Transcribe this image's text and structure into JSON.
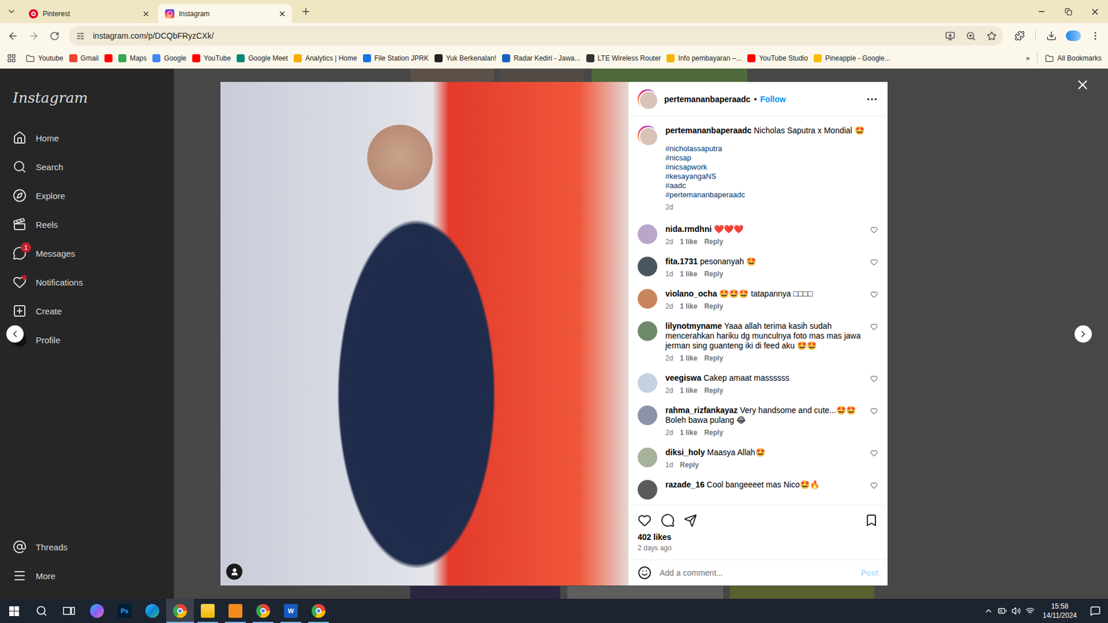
{
  "browser": {
    "tabs": [
      {
        "label": "Pinterest",
        "selected": false
      },
      {
        "label": "Instagram",
        "selected": true
      }
    ],
    "url": "instagram.com/p/DCQbFRyzCXk/",
    "bookmarks": [
      {
        "label": "Youtube",
        "kind": "folder"
      },
      {
        "label": "Gmail",
        "kind": "site",
        "color": "#ea4335"
      },
      {
        "kind": "site",
        "color": "#ff0000"
      },
      {
        "label": "Maps",
        "kind": "site",
        "color": "#34a853"
      },
      {
        "label": "Google",
        "kind": "site",
        "color": "#4285f4"
      },
      {
        "label": "YouTube",
        "kind": "site",
        "color": "#ff0000"
      },
      {
        "label": "Google Meet",
        "kind": "site",
        "color": "#00897b"
      },
      {
        "label": "Analytics | Home",
        "kind": "site",
        "color": "#f9ab00"
      },
      {
        "label": "File Station JPRK",
        "kind": "site",
        "color": "#1a73e8"
      },
      {
        "label": "Yuk Berkenalan!",
        "kind": "site",
        "color": "#222222"
      },
      {
        "label": "Radar Kediri - Jawa...",
        "kind": "site",
        "color": "#1565c0"
      },
      {
        "label": "LTE Wireless Router",
        "kind": "site",
        "color": "#333333"
      },
      {
        "label": "Info pembayaran –...",
        "kind": "site",
        "color": "#f4b400"
      },
      {
        "label": "YouTube Studio",
        "kind": "site",
        "color": "#ff0000"
      },
      {
        "label": "Pineapple - Google...",
        "kind": "site",
        "color": "#fbbc04"
      }
    ],
    "overflow": "»",
    "all_bookmarks": "All Bookmarks"
  },
  "sidebar": {
    "logo": "Instagram",
    "items": [
      {
        "label": "Home",
        "kind": "nav"
      },
      {
        "label": "Search",
        "kind": "nav"
      },
      {
        "label": "Explore",
        "kind": "nav"
      },
      {
        "label": "Reels",
        "kind": "nav"
      },
      {
        "label": "Messages",
        "kind": "nav",
        "badge": "1"
      },
      {
        "label": "Notifications",
        "kind": "nav",
        "dot": true
      },
      {
        "label": "Create",
        "kind": "nav"
      },
      {
        "label": "Profile",
        "kind": "avatar"
      }
    ],
    "bottom_items": [
      {
        "label": "Threads"
      },
      {
        "label": "More"
      }
    ]
  },
  "post": {
    "username": "pertemananbaperaadc",
    "separator": "•",
    "follow": "Follow",
    "caption": {
      "text": "Nicholas Saputra x Mondial 🤩",
      "hashtags": [
        "#nicholassaputra",
        "#nicsap",
        "#nicsapwork",
        "#kesayangaNS",
        "#aadc",
        "#pertemananbaperaadc"
      ],
      "time": "2d"
    },
    "comments": [
      {
        "username": "nida.rmdhni",
        "text": "❤️❤️❤️",
        "time": "2d",
        "likes": "1 like",
        "reply": "Reply",
        "liked": false
      },
      {
        "username": "fita.1731",
        "text": "pesonanyah 🤩",
        "time": "1d",
        "likes": "1 like",
        "reply": "Reply",
        "liked": false
      },
      {
        "username": "violano_ocha",
        "text": "🤩🤩🤩 tatapannya □□□□",
        "time": "2d",
        "likes": "1 like",
        "reply": "Reply",
        "liked": false
      },
      {
        "username": "lilynotmyname",
        "text": "Yaaa allah terima kasih sudah mencerahkan hariku dg munculnya foto mas mas jawa jerman sing guanteng iki di feed aku 🤩🤩",
        "time": "2d",
        "likes": "1 like",
        "reply": "Reply",
        "liked": false
      },
      {
        "username": "veegiswa",
        "text": "Cakep amaat massssss",
        "time": "2d",
        "likes": "1 like",
        "reply": "Reply",
        "liked": false
      },
      {
        "username": "rahma_rizfankayaz",
        "text": "Very handsome and cute...🤩🤩 Boleh bawa pulang 😂",
        "time": "2d",
        "likes": "1 like",
        "reply": "Reply",
        "liked": false
      },
      {
        "username": "diksi_holy",
        "text": "Maasya Allah🤩",
        "time": "1d",
        "reply": "Reply",
        "liked": false
      },
      {
        "username": "razade_16",
        "text": "Cool bangeeeet mas Nico🤩🔥",
        "liked": false
      }
    ],
    "liked": false,
    "saved": false,
    "likes": "402 likes",
    "date": "2 days ago",
    "comment_placeholder": "Add a comment...",
    "post_button": "Post",
    "post_enabled": false
  },
  "taskbar": {
    "apps": [
      {
        "running": false,
        "active": false
      },
      {
        "running": false,
        "active": false,
        "glyph": "Ps"
      },
      {
        "running": false,
        "active": false
      },
      {
        "running": true,
        "active": true
      },
      {
        "running": true,
        "active": false
      },
      {
        "running": true,
        "active": false
      },
      {
        "running": true,
        "active": false
      },
      {
        "running": true,
        "active": false,
        "glyph": "W"
      },
      {
        "running": true,
        "active": false
      }
    ],
    "clock": {
      "time": "15:58",
      "date": "14/11/2024"
    }
  }
}
